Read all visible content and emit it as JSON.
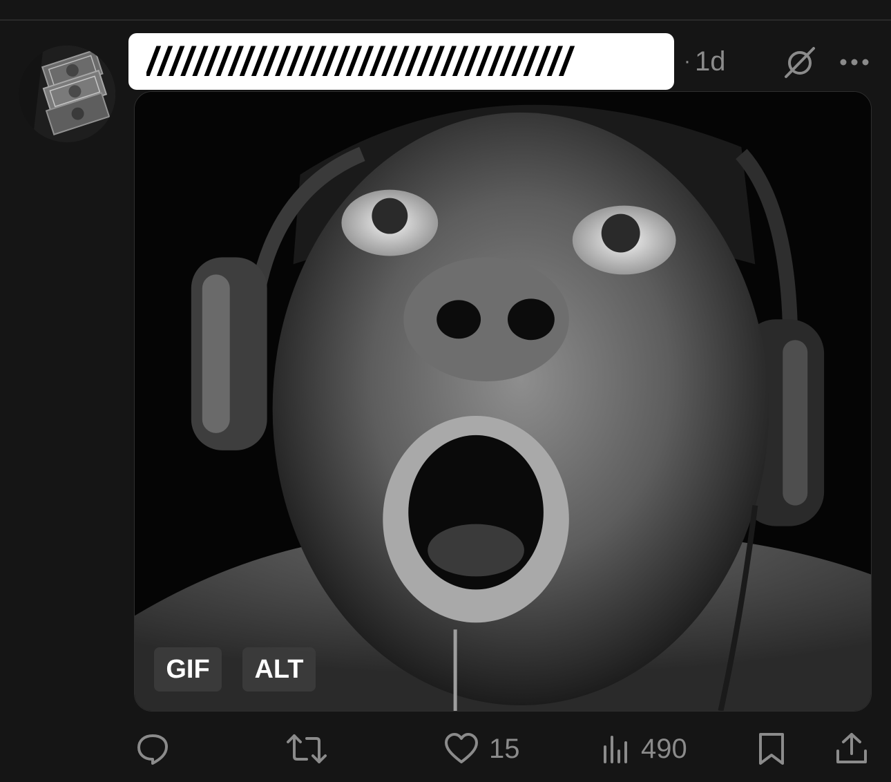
{
  "post": {
    "author_name": "////////////////////////////////////",
    "timestamp_separator": "·",
    "timestamp": "1d",
    "media": {
      "gif_badge": "GIF",
      "alt_badge": "ALT"
    },
    "actions": {
      "reply_icon": "speech-bubble-icon",
      "repost_icon": "repost-arrows-icon",
      "like_icon": "heart-icon",
      "like_count": "15",
      "views_icon": "bar-chart-icon",
      "views_count": "490",
      "bookmark_icon": "bookmark-icon",
      "share_icon": "share-upload-icon"
    }
  },
  "colors": {
    "background": "#151515",
    "muted_text": "#8b8b8b",
    "name_box_bg": "#ffffff"
  }
}
